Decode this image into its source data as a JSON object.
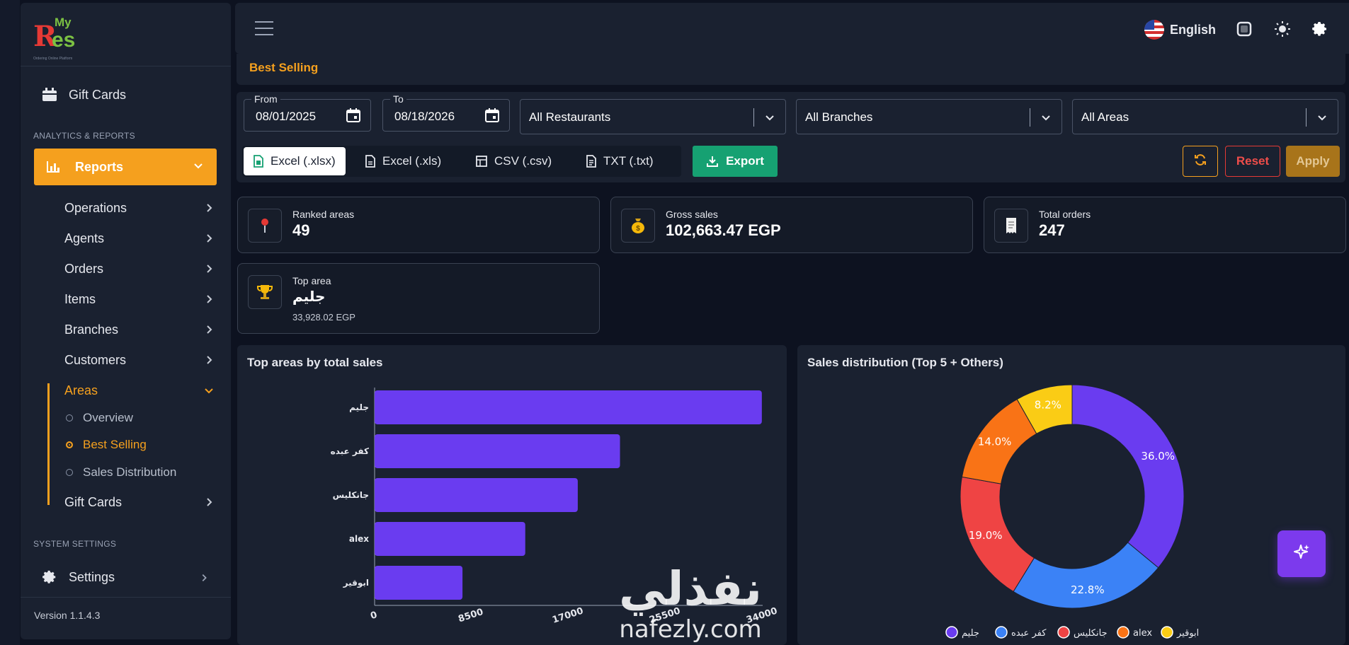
{
  "sidebar": {
    "logo": {
      "my": "My",
      "r": "R",
      "es": "es",
      "tagline": "Ordering Online Platform"
    },
    "gift_cards_top": "Gift Cards",
    "section_analytics": "ANALYTICS & REPORTS",
    "reports": "Reports",
    "sub_items": [
      "Operations",
      "Agents",
      "Orders",
      "Items",
      "Branches",
      "Customers"
    ],
    "areas": "Areas",
    "area_children": [
      "Overview",
      "Best Selling",
      "Sales Distribution"
    ],
    "gift_cards_sub": "Gift Cards",
    "section_system": "SYSTEM SETTINGS",
    "settings": "Settings",
    "version": "Version 1.1.4.3"
  },
  "topbar": {
    "language": "English"
  },
  "breadcrumb": "Best Selling",
  "filters": {
    "from_label": "From",
    "from_value": "08/01/2025",
    "to_label": "To",
    "to_value": "08/18/2026",
    "restaurants": "All Restaurants",
    "branches": "All Branches",
    "areas": "All Areas",
    "formats": [
      "Excel (.xlsx)",
      "Excel (.xls)",
      "CSV (.csv)",
      "TXT (.txt)"
    ],
    "export": "Export",
    "reset": "Reset",
    "apply": "Apply"
  },
  "stats": {
    "ranked_areas": {
      "label": "Ranked areas",
      "value": "49"
    },
    "gross_sales": {
      "label": "Gross sales",
      "value": "102,663.47 EGP"
    },
    "total_orders": {
      "label": "Total orders",
      "value": "247"
    },
    "top_area": {
      "label": "Top area",
      "value": "جليم",
      "sub": "33,928.02 EGP"
    }
  },
  "colors": {
    "accent": "#f5a01e",
    "bar": "#6a3cf0",
    "export": "#16a172",
    "danger": "#e53935"
  },
  "chart_data": [
    {
      "type": "bar",
      "orientation": "horizontal",
      "title": "Top areas by total sales",
      "categories": [
        "جليم",
        "كفر عبده",
        "جانكليس",
        "alex",
        "ابوقير"
      ],
      "values": [
        33928,
        21500,
        17800,
        13200,
        7700
      ],
      "xlim": [
        0,
        34000
      ],
      "xticks": [
        "0",
        "8500",
        "17000",
        "25500",
        "34000"
      ]
    },
    {
      "type": "pie",
      "title": "Sales distribution (Top 5 + Others)",
      "donut": true,
      "categories": [
        "جليم",
        "كفر عبده",
        "جانكليس",
        "alex",
        "ابوقير"
      ],
      "values": [
        36.0,
        22.8,
        19.0,
        14.0,
        8.2
      ],
      "labels": [
        "36.0%",
        "22.8%",
        "19.0%",
        "14.0%",
        "8.2%"
      ],
      "colors": [
        "#6a3cf0",
        "#3b82f6",
        "#ef4444",
        "#f97316",
        "#facc15"
      ],
      "legend": "bottom"
    }
  ],
  "watermark": {
    "arabic": "نفذلي",
    "domain": "nafezly.com"
  }
}
